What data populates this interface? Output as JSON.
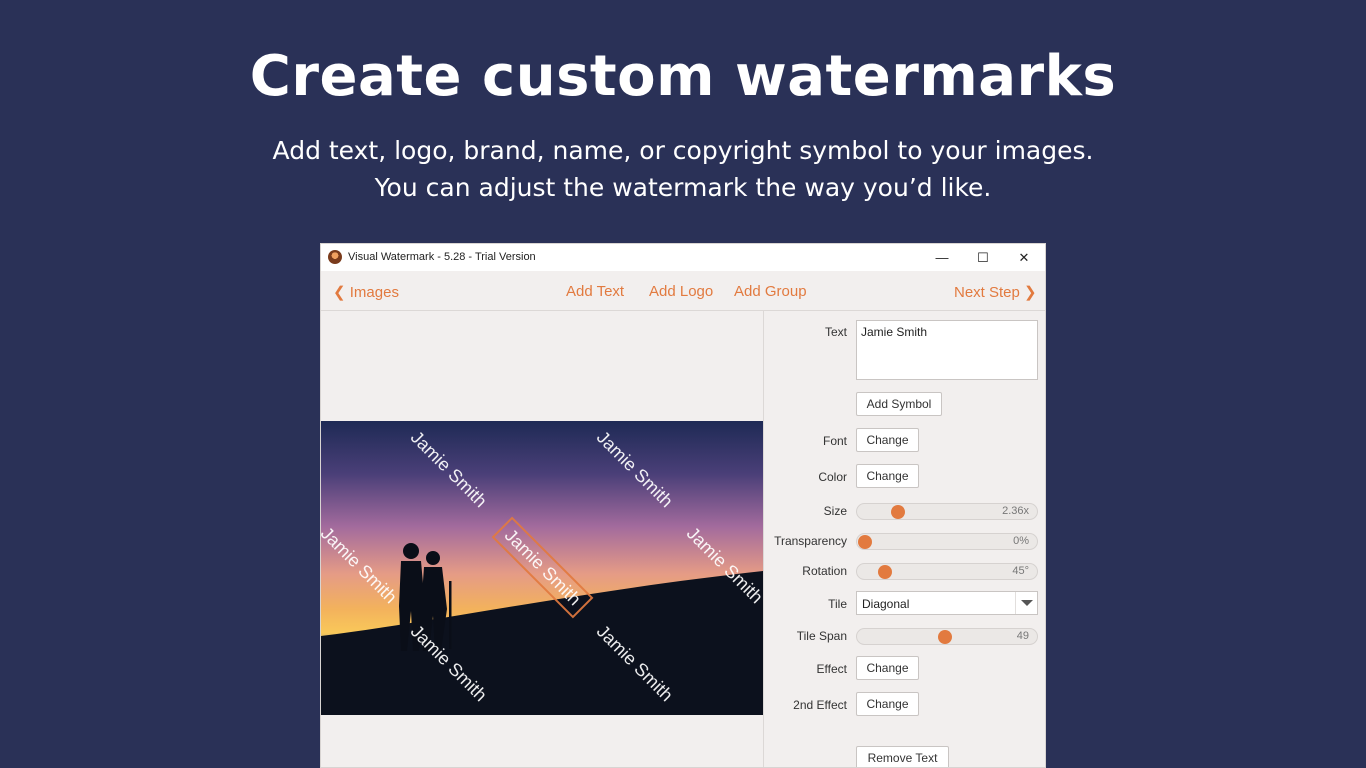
{
  "hero": {
    "title": "Create custom watermarks",
    "subtitle_line1": "Add text, logo, brand, name, or copyright symbol to your images.",
    "subtitle_line2": "You can adjust the watermark the way you’d like."
  },
  "window": {
    "title": "Visual Watermark - 5.28 - Trial Version",
    "controls": {
      "minimize": "—",
      "maximize": "☐",
      "close": "✕"
    }
  },
  "toolbar": {
    "back_label": "Images",
    "add_text": "Add Text",
    "add_logo": "Add Logo",
    "add_group": "Add Group",
    "next_label": "Next Step"
  },
  "preview": {
    "watermark_text": "Jamie Smith"
  },
  "panel": {
    "text_label": "Text",
    "text_value": "Jamie Smith",
    "add_symbol": "Add Symbol",
    "font_label": "Font",
    "color_label": "Color",
    "change": "Change",
    "size_label": "Size",
    "size_value": "2.36x",
    "size_level": 0.2,
    "transparency_label": "Transparency",
    "transparency_value": "0%",
    "transparency_level": 0.0,
    "rotation_label": "Rotation",
    "rotation_value": "45°",
    "rotation_level": 0.12,
    "tile_label": "Tile",
    "tile_value": "Diagonal",
    "tile_span_label": "Tile Span",
    "tile_span_value": "49",
    "tile_span_level": 0.49,
    "effect_label": "Effect",
    "effect2_label": "2nd Effect",
    "remove_text": "Remove Text"
  },
  "colors": {
    "background": "#2a3157",
    "accent": "#e27a3f",
    "window_bg": "#f2efee"
  }
}
